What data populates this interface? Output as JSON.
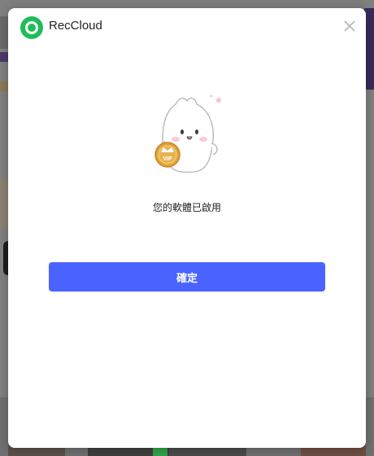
{
  "app": {
    "title": "RecCloud"
  },
  "dialog": {
    "message": "您的軟體已啟用",
    "confirm_label": "確定",
    "vip_badge": "VIP"
  },
  "icons": {
    "logo": "reccloud-logo-icon",
    "close": "close-icon",
    "mascot": "mascot-illustration"
  },
  "colors": {
    "accent": "#4a63ff",
    "logo_green": "#1ebd5a",
    "badge_gold": "#e0a33a"
  }
}
